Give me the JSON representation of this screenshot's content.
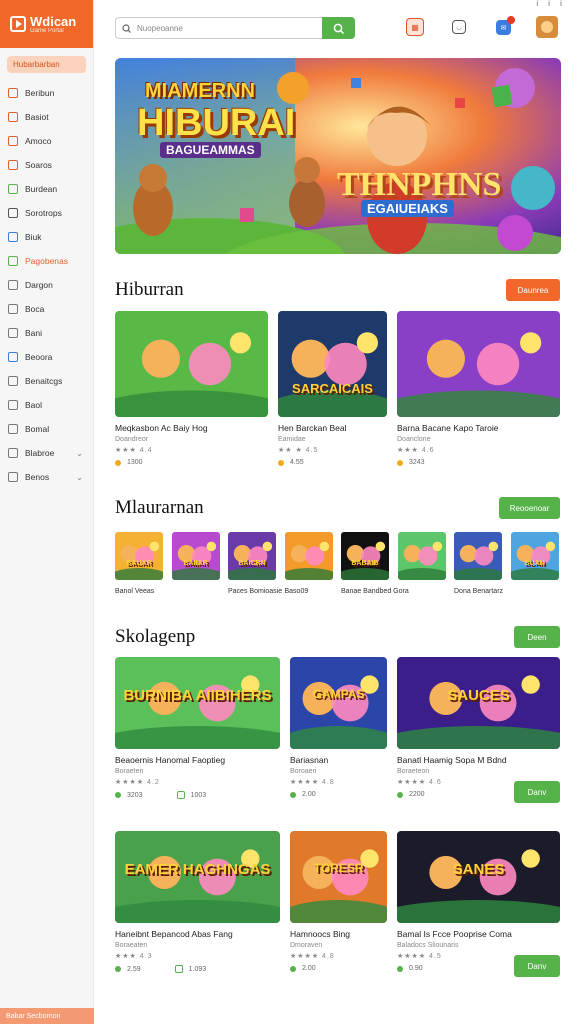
{
  "app": {
    "logo_title": "Wdican",
    "logo_sub": "Game Portal",
    "top_right": "ⅰ ⅰ ⅰ"
  },
  "sidebar": {
    "highlight": "Hubarbarban",
    "items": [
      {
        "label": "Beribun"
      },
      {
        "label": "Basiot"
      },
      {
        "label": "Amoco"
      },
      {
        "label": "Soaros"
      },
      {
        "label": "Burdean"
      },
      {
        "label": "Sorotrops"
      },
      {
        "label": "Biuk"
      },
      {
        "label": "Pagobenas"
      },
      {
        "label": "Dargon"
      },
      {
        "label": "Boca"
      },
      {
        "label": "Bani"
      },
      {
        "label": "Beoora"
      },
      {
        "label": "Benaitcgs"
      },
      {
        "label": "Baol"
      },
      {
        "label": "Bomal"
      },
      {
        "label": "Blabroe"
      },
      {
        "label": "Benos"
      }
    ],
    "bottom": "Babar Secbornon"
  },
  "search": {
    "placeholder": "Nuopeoanne"
  },
  "hero": {
    "line1": "MIAMERNN",
    "line2": "HIBURAI",
    "line3": "BAGUEAMMAS",
    "line4": "THNPHNS",
    "line5": "EGAIUEIAKS"
  },
  "section1": {
    "title": "Hiburran",
    "button": "Daunrea",
    "cards": [
      {
        "title": "Meqkasbon Ac Baiy Hog",
        "sub": "Doandreor",
        "stars": "★★★ 4.4",
        "count": "1300"
      },
      {
        "title": "Hen Barckan Beal",
        "sub": "Eamidae",
        "stars": "★★ ★ 4.5",
        "count": "4.55",
        "label": "SARCAICAIS"
      },
      {
        "title": "Barna Bacane Kapo Taroie",
        "sub": "Doanclone",
        "stars": "★★★ 4.6",
        "count": "3243"
      }
    ]
  },
  "section2": {
    "title": "Mlaurarnan",
    "button": "Reooenoar",
    "items": [
      {
        "title": "Banol Veeas",
        "label": "BAUAR"
      },
      {
        "title": "",
        "label": "BAIIAR"
      },
      {
        "title": "Paces Bomioasie",
        "label": "BAICRN"
      },
      {
        "title": "Baso09",
        "label": ""
      },
      {
        "title": "Banae Bandbed Gora",
        "label": "BABAIB"
      },
      {
        "title": "",
        "label": ""
      },
      {
        "title": "Dona Benartarz",
        "label": ""
      },
      {
        "title": "",
        "label": "BUAN"
      }
    ]
  },
  "section3": {
    "title": "Skolagenp",
    "button": "Deen",
    "cards": [
      {
        "title": "Beaoernis Hanomal Faoptieg",
        "sub": "Boraeten",
        "stars": "★★★★ 4.2",
        "count": "3203",
        "extra": "1003",
        "label": "BURNIBA AIIBIHERS"
      },
      {
        "title": "Bariasnan",
        "sub": "Boroaeri",
        "stars": "★★★★ 4.8",
        "count": "2.00",
        "label": "GAMPAS"
      },
      {
        "title": "Banatl Haamig Sopa M Bdnd",
        "sub": "Boraeteon",
        "stars": "★★★★ 4.6",
        "count": "2200",
        "button": "Danv",
        "label": "SAUCES"
      },
      {
        "title": "Haneibnt Bepancod Abas Fang",
        "sub": "Boraeaten",
        "stars": "★★★ 4.3",
        "count": "2.59",
        "extra": "1.093",
        "label": "EAMER HAGHNGAS"
      },
      {
        "title": "Hamnoocs Bing",
        "sub": "Dmoraven",
        "stars": "★★★★ 4.8",
        "count": "2.00",
        "label": "TORESR"
      },
      {
        "title": "Bamal Is Fcce Pooprise Coma",
        "sub": "Baladocs Sliounaris",
        "stars": "★★★★ 4.5",
        "count": "0.90",
        "button": "Danv",
        "label": "SANES"
      }
    ]
  },
  "colors": {
    "accent": "#f2682a",
    "green": "#56b34a"
  }
}
